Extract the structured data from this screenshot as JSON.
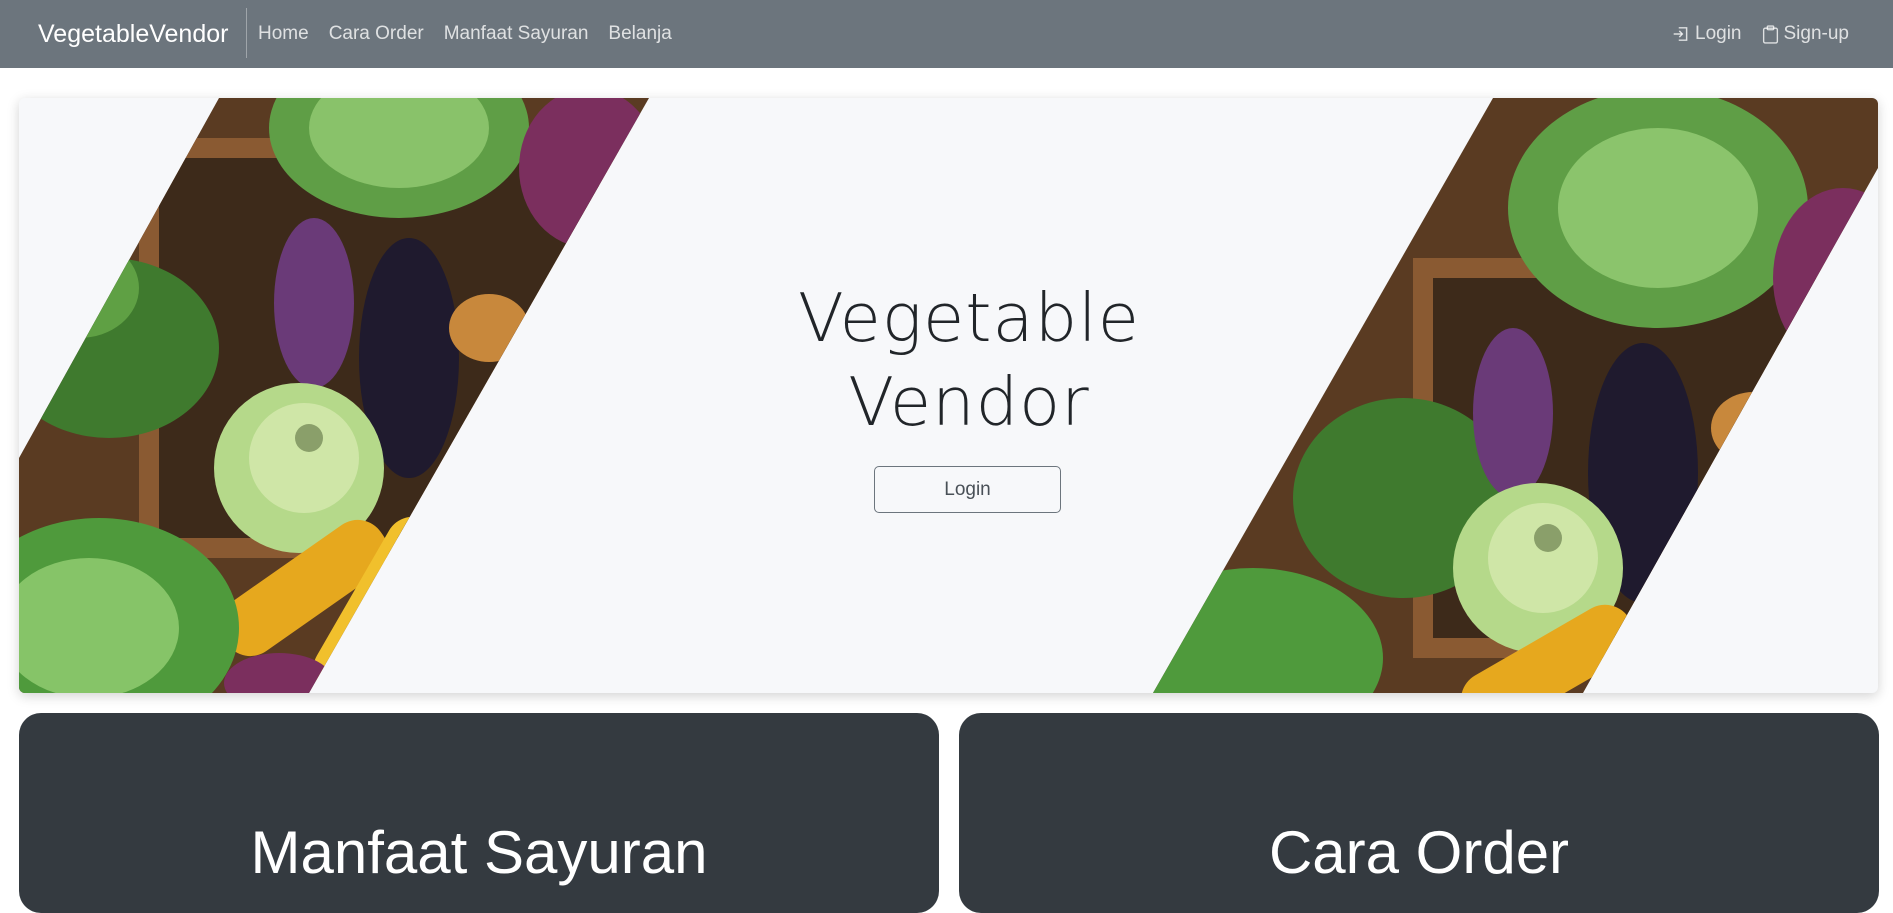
{
  "navbar": {
    "brand": "VegetableVendor",
    "links": [
      "Home",
      "Cara Order",
      "Manfaat Sayuran",
      "Belanja"
    ],
    "login": "Login",
    "signup": "Sign-up",
    "login_icon": "login-icon",
    "signup_icon": "clipboard-icon"
  },
  "hero": {
    "title_line1": "Vegetable",
    "title_line2": "Vendor",
    "button": "Login",
    "image_left": "vegetable-crate-image",
    "image_right": "vegetable-crate-image"
  },
  "cards": [
    {
      "title": "Manfaat Sayuran"
    },
    {
      "title": "Cara Order"
    }
  ],
  "colors": {
    "navbar_bg": "#6c757d",
    "hero_bg": "#f7f8fa",
    "card_bg": "#343a40"
  }
}
